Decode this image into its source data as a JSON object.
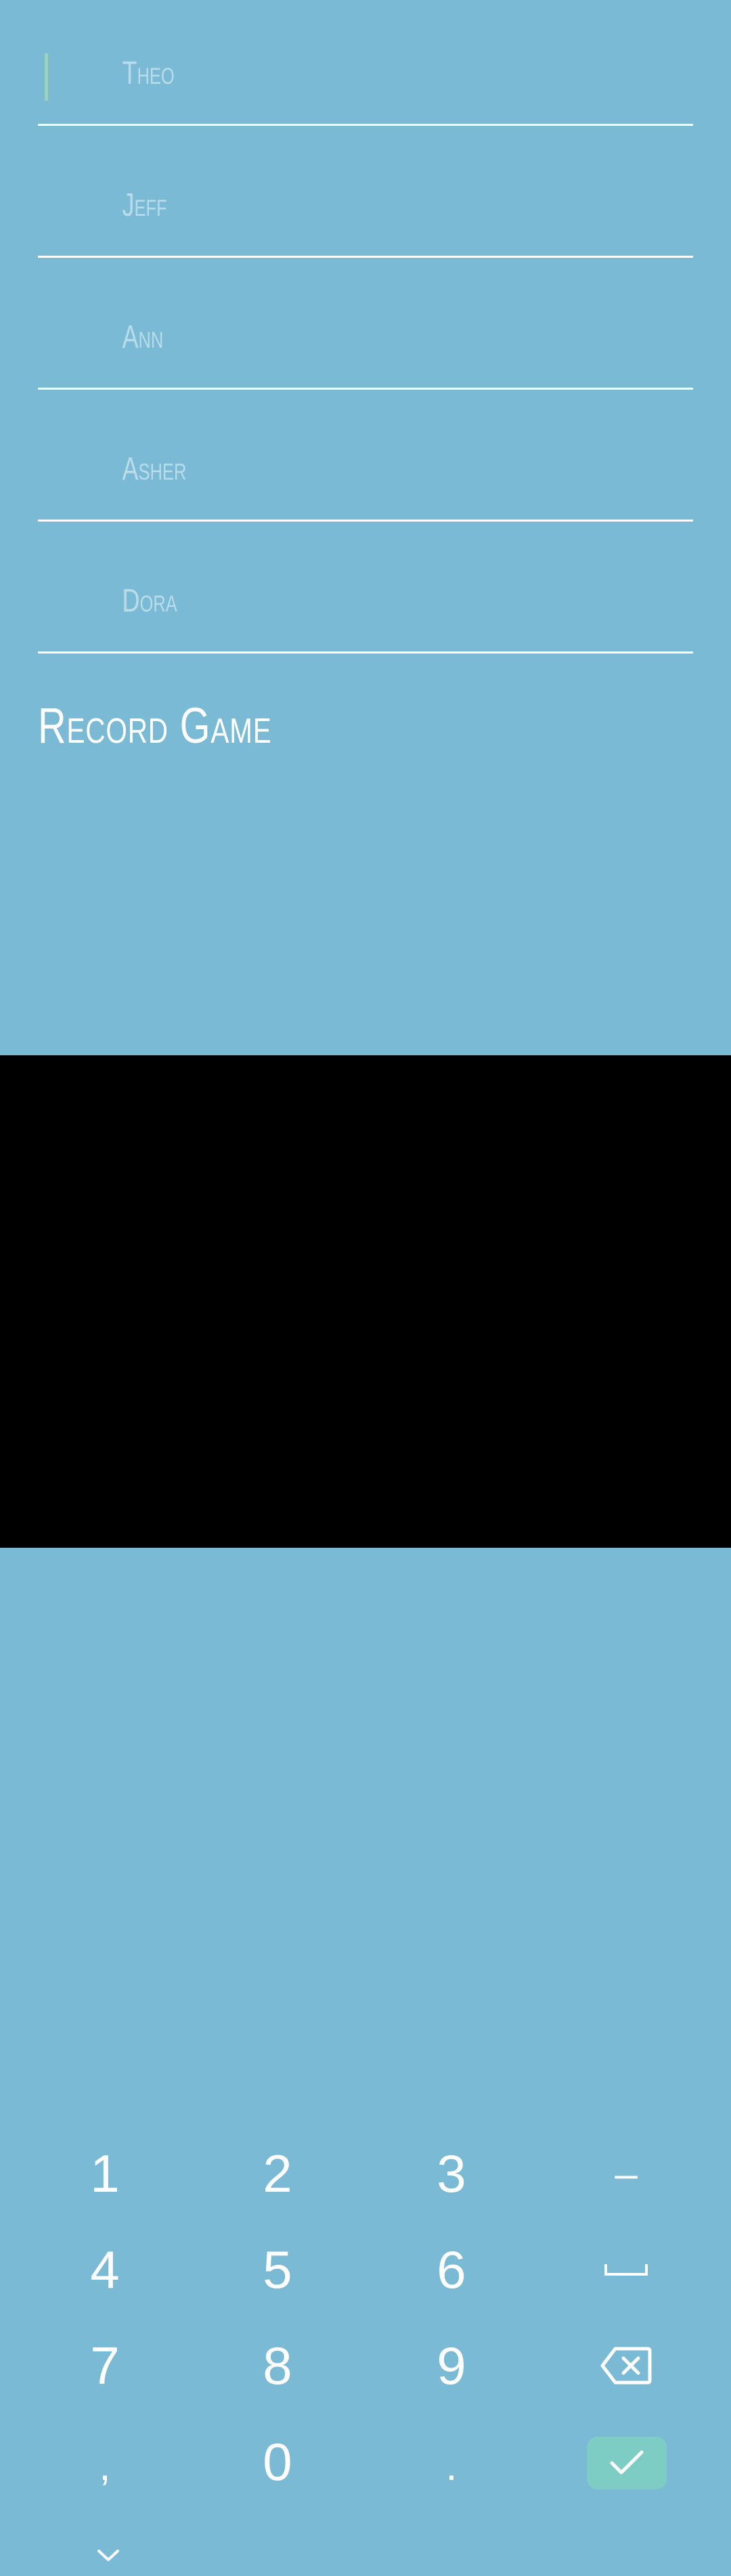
{
  "players": [
    {
      "placeholder": "Theo",
      "value": ""
    },
    {
      "placeholder": "Jeff",
      "value": ""
    },
    {
      "placeholder": "Ann",
      "value": ""
    },
    {
      "placeholder": "Asher",
      "value": ""
    },
    {
      "placeholder": "Dora",
      "value": ""
    }
  ],
  "record_game_label": "Record Game",
  "keyboard": {
    "row1": [
      "1",
      "2",
      "3",
      "–"
    ],
    "row2": [
      "4",
      "5",
      "6"
    ],
    "row3": [
      "7",
      "8",
      "9"
    ],
    "row4": [
      ",",
      "0",
      "."
    ],
    "space_icon": "space-bar-icon",
    "backspace_icon": "backspace-icon",
    "confirm_icon": "checkmark-icon",
    "collapse_icon": "chevron-down-icon",
    "confirm_color": "#7ecdc5"
  },
  "colors": {
    "background": "#7bbad5",
    "keyboard_background": "#000000",
    "placeholder_text": "#b9dceb",
    "underline": "#ffffff"
  }
}
